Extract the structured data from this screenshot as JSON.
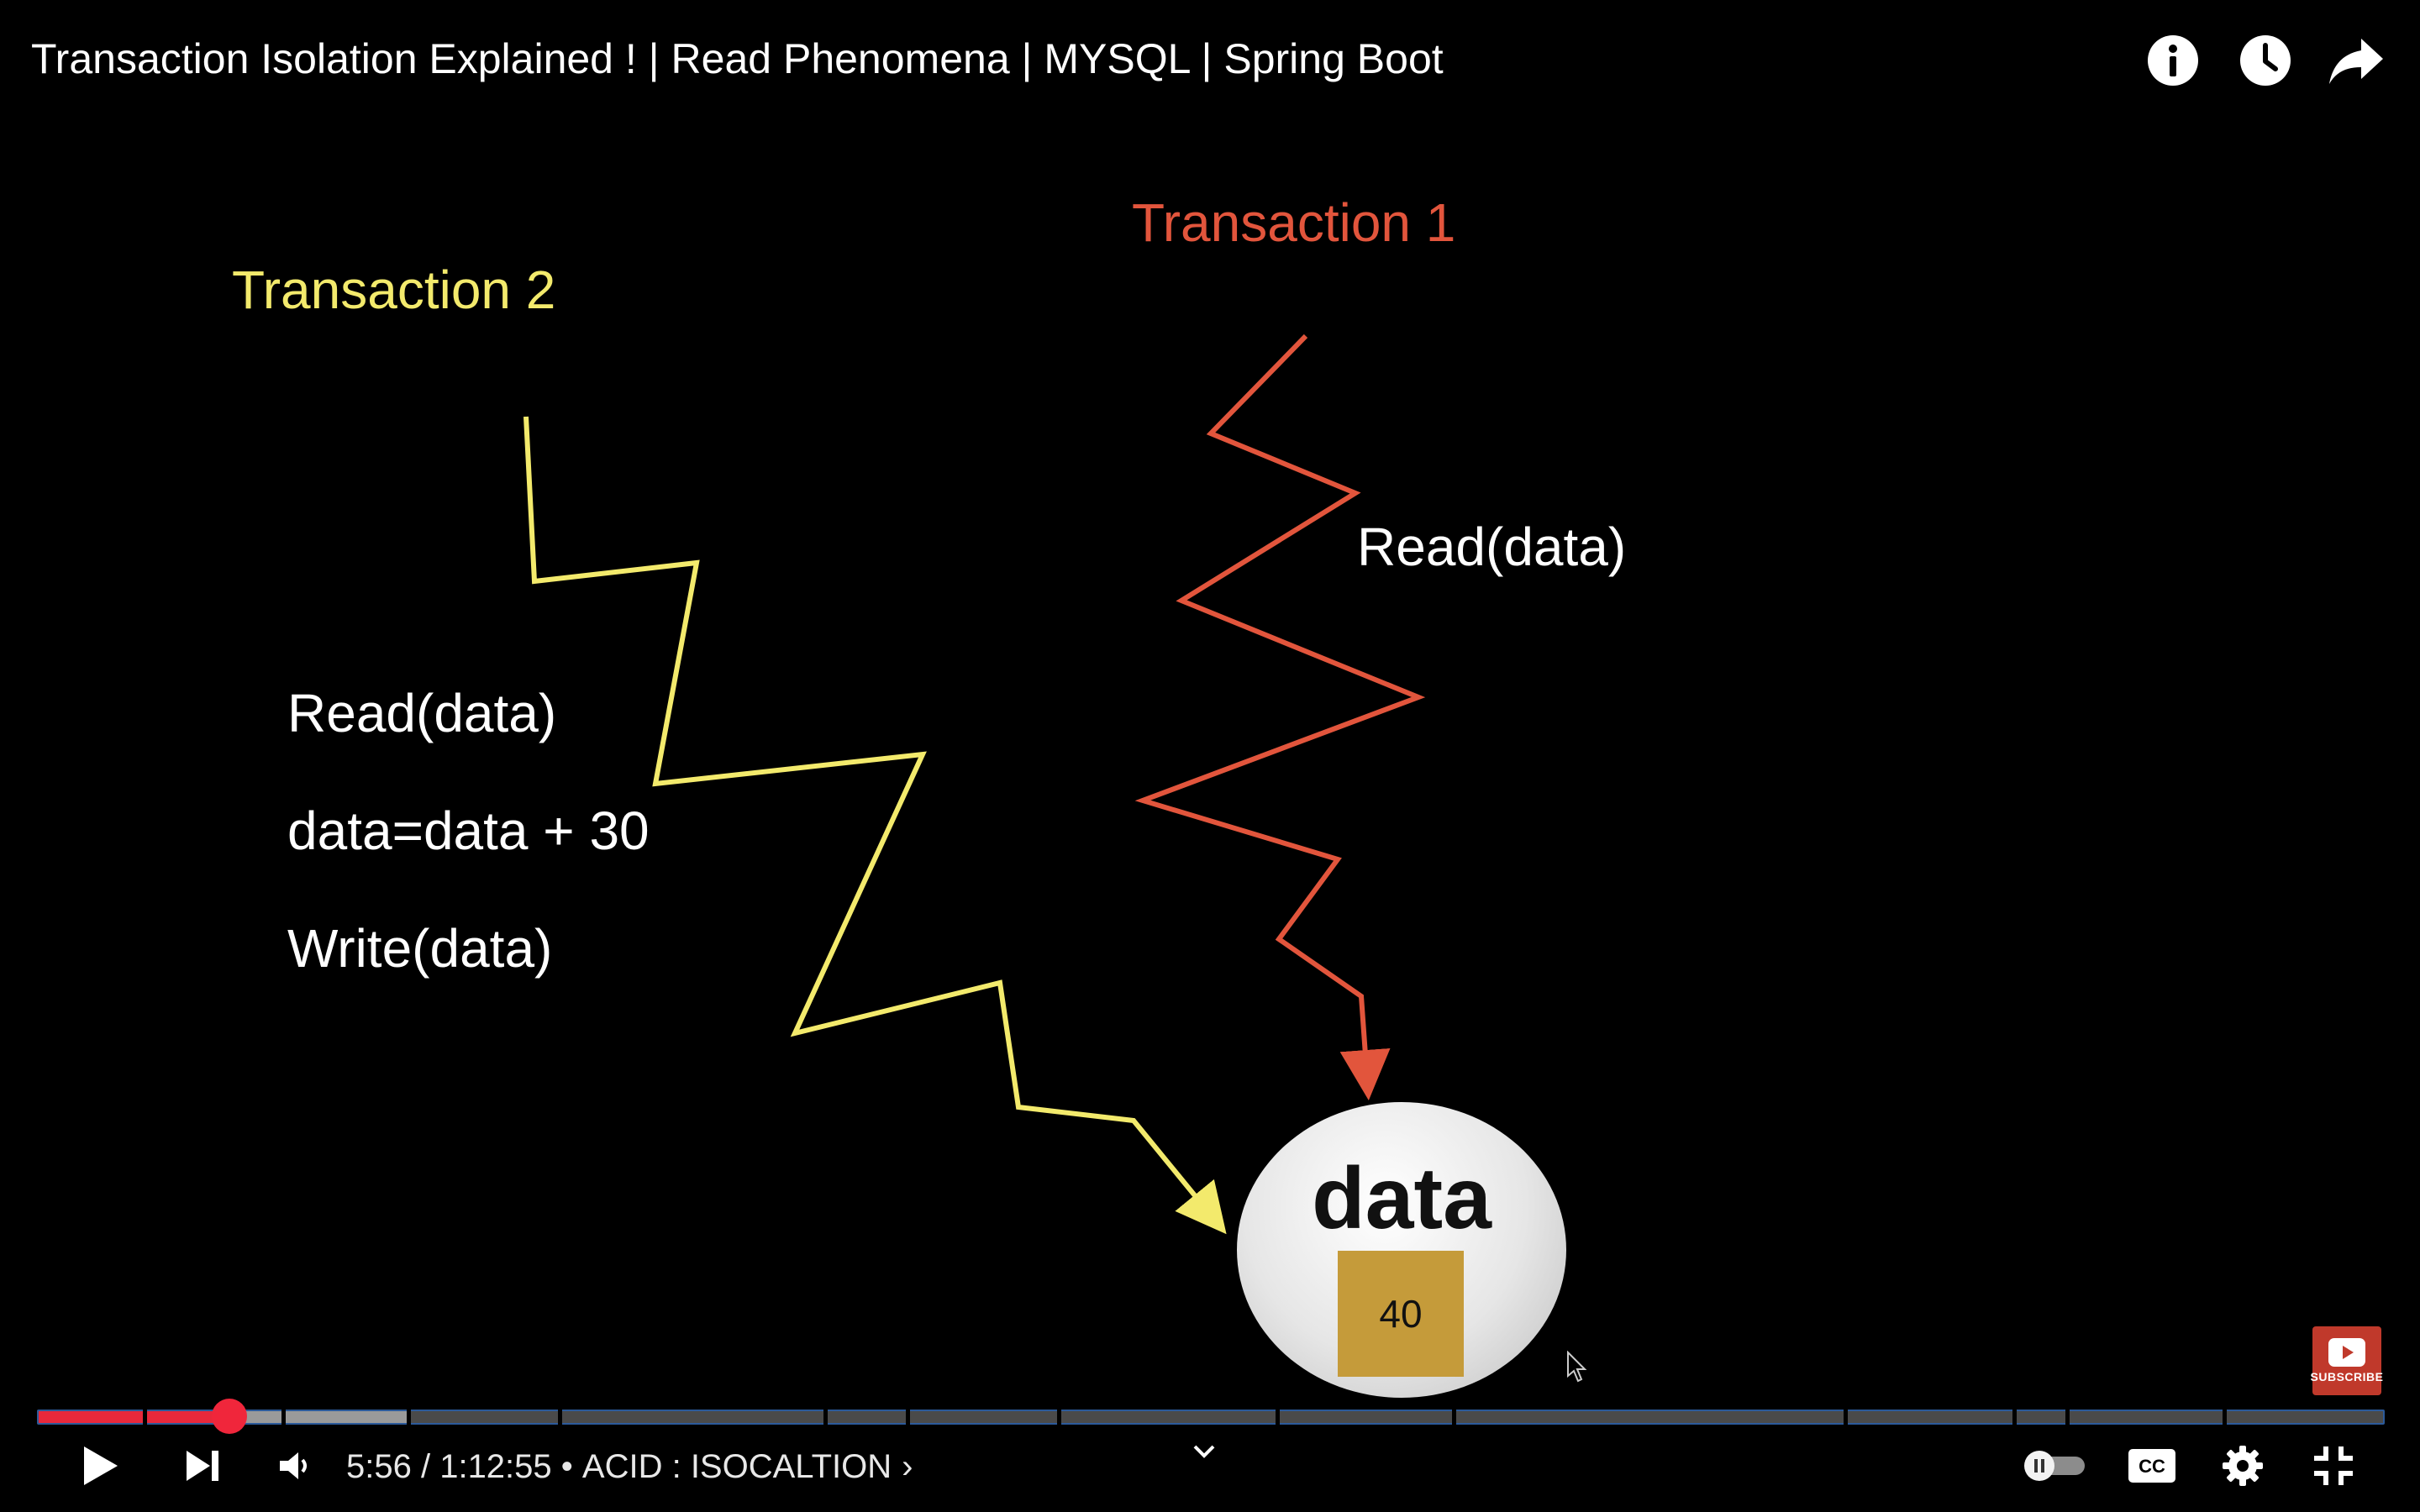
{
  "video": {
    "title": "Transaction Isolation Explained ! | Read Phenomena | MYSQL | Spring Boot"
  },
  "top_actions": [
    {
      "name": "info-icon"
    },
    {
      "name": "watch-later-icon"
    },
    {
      "name": "share-icon"
    }
  ],
  "slide": {
    "transaction_2_label": "Transaction 2",
    "transaction_1_label": "Transaction 1",
    "t1_operation": "Read(data)",
    "t2_operations": [
      "Read(data)",
      "data=data + 30",
      "Write(data)"
    ],
    "data_label": "data",
    "data_value": "40",
    "colors": {
      "transaction_2": "#f3ea6c",
      "transaction_1": "#e2553c",
      "data_box": "#c59b3a"
    }
  },
  "watermark": {
    "label": "SUBSCRIBE"
  },
  "player": {
    "current_time": "5:56",
    "separator": " / ",
    "duration": "1:12:55",
    "chapter_separator": " • ",
    "chapter": "ACID : ISOCALTION",
    "chapter_arrow": "›",
    "progress_fraction": 0.0814,
    "buffered_fraction": 0.1585,
    "accent_color": "#e8283b",
    "controls": [
      {
        "name": "play-icon"
      },
      {
        "name": "next-icon"
      },
      {
        "name": "volume-icon"
      },
      {
        "name": "chevron-down-icon"
      },
      {
        "name": "autoplay-toggle"
      },
      {
        "name": "captions-icon"
      },
      {
        "name": "settings-gear-icon"
      },
      {
        "name": "exit-fullscreen-icon"
      }
    ]
  }
}
